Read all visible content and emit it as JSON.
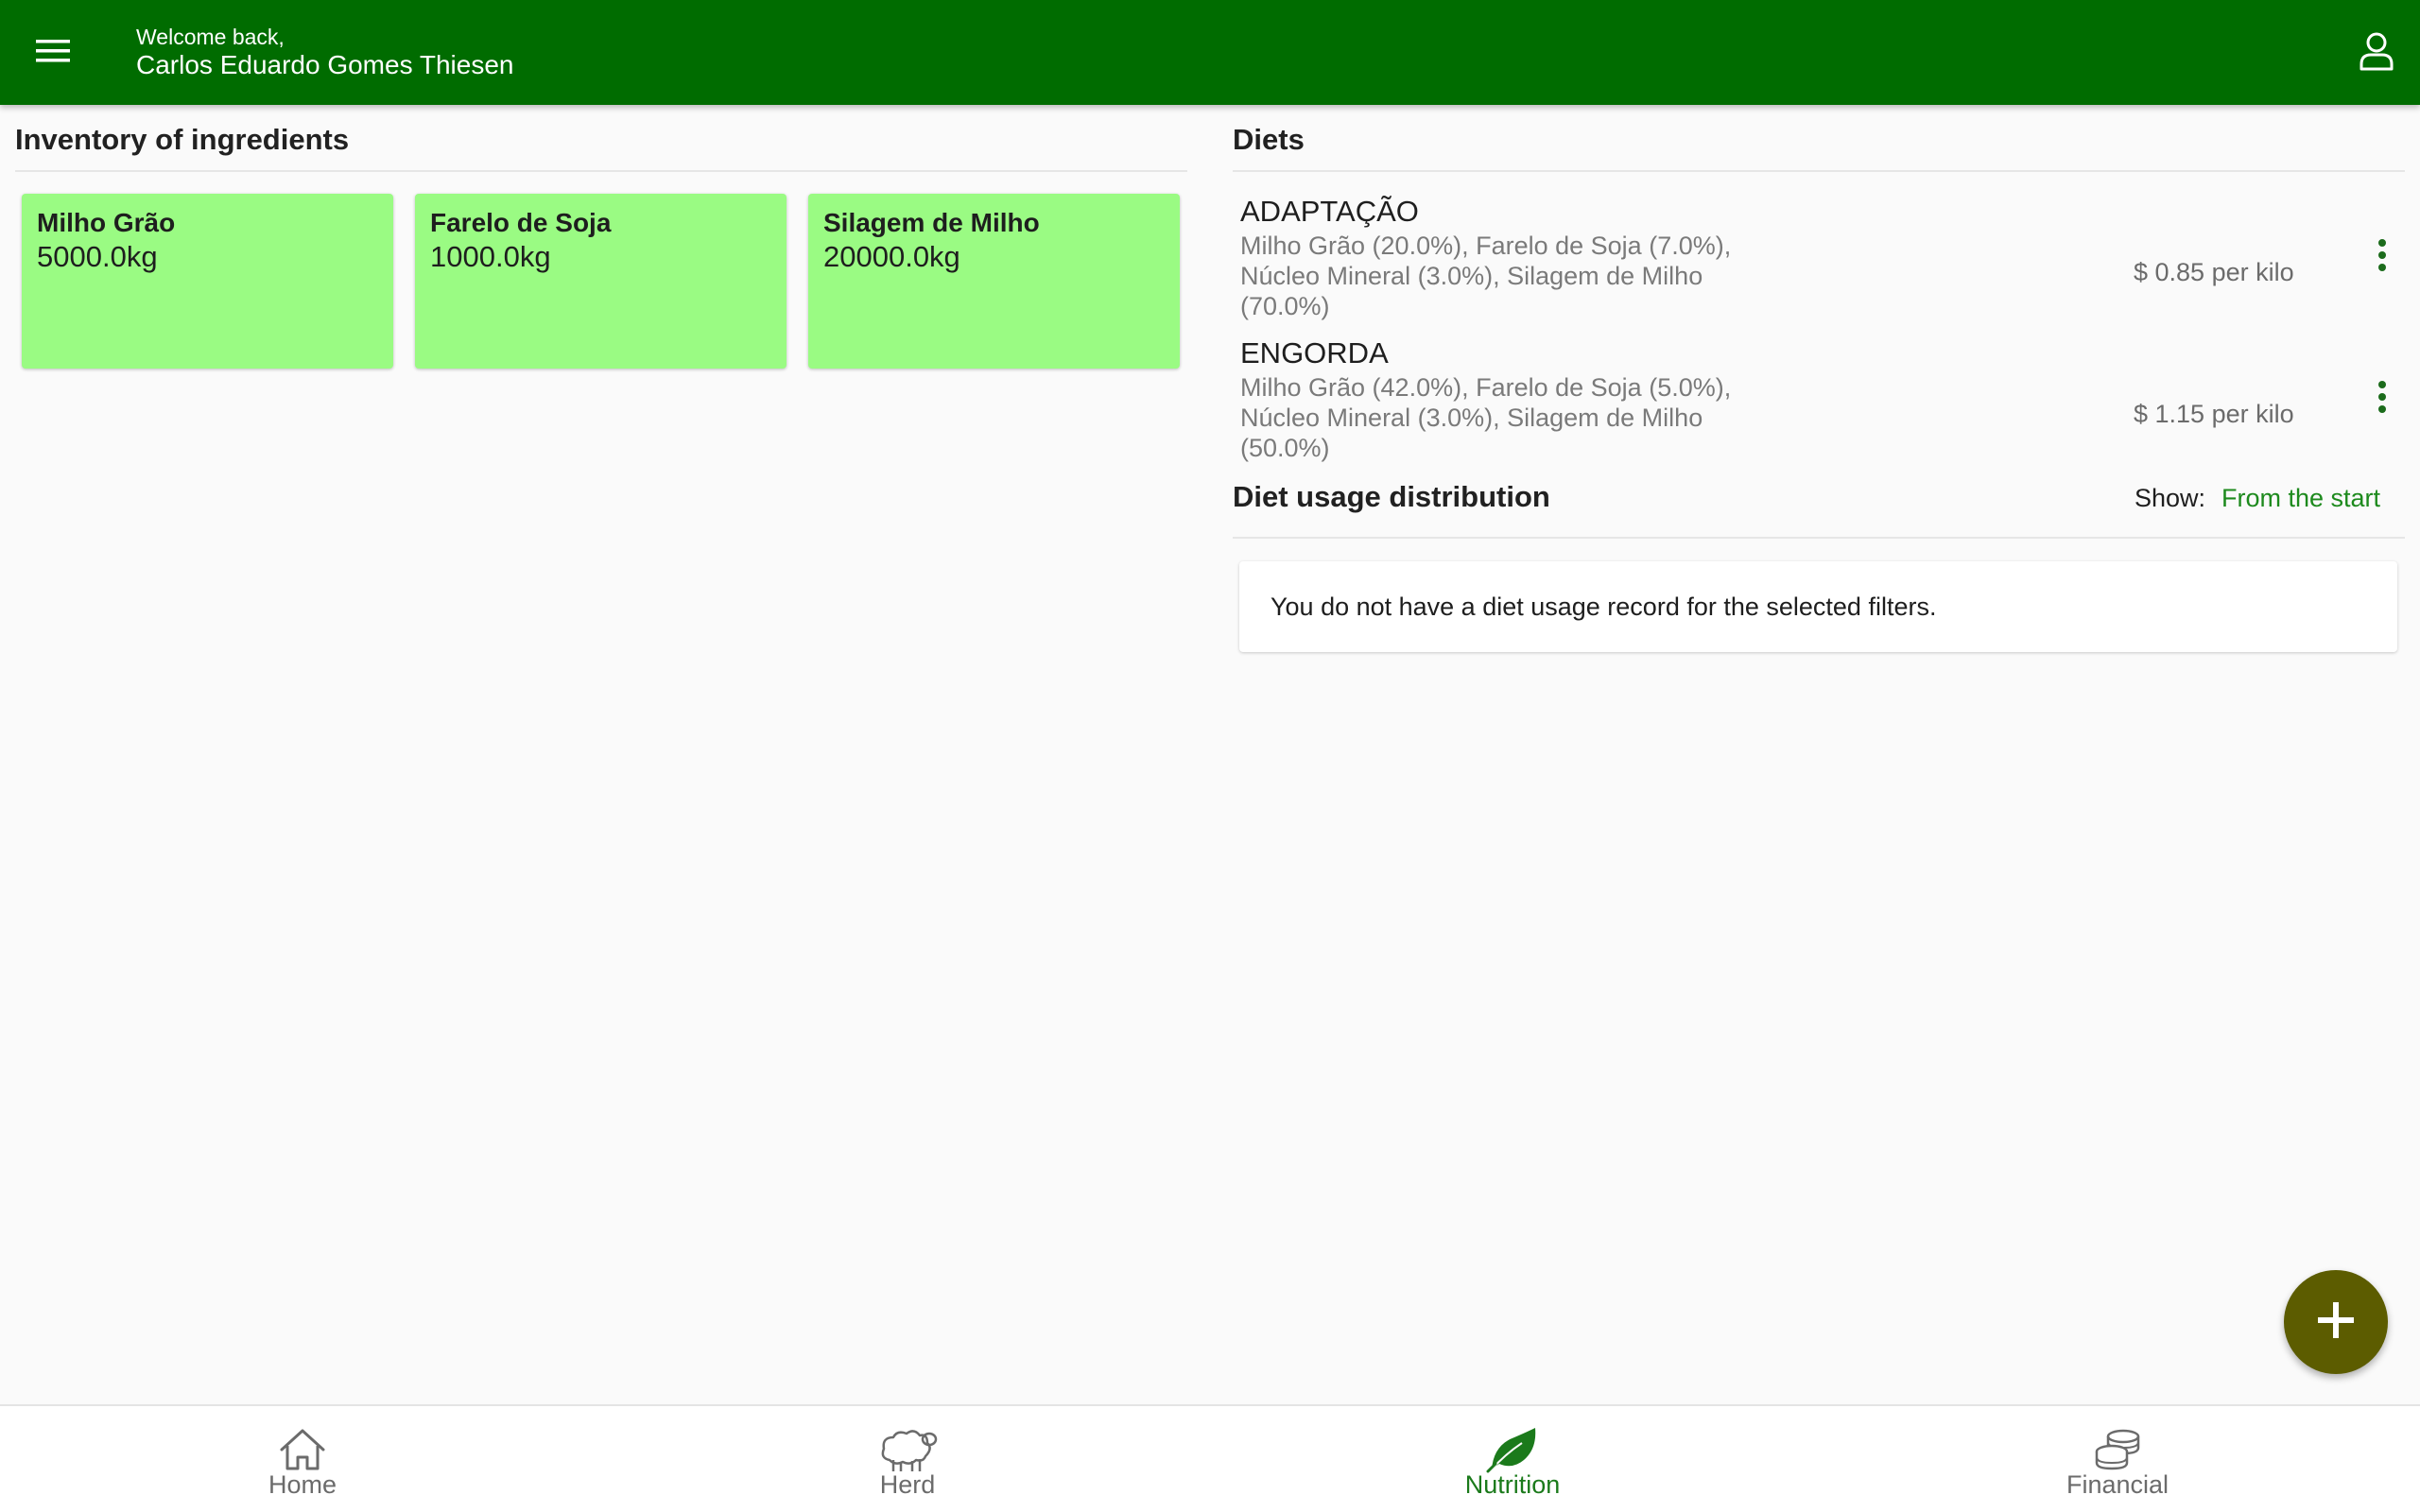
{
  "appbar": {
    "greeting": "Welcome back,",
    "user_name": "Carlos Eduardo Gomes Thiesen",
    "color": "#006c00",
    "menu_icon": "hamburger-menu-icon",
    "account_icon": "person-icon"
  },
  "inventory": {
    "title": "Inventory of ingredients",
    "card_color": "#9afb83",
    "items": [
      {
        "name": "Milho Grão",
        "quantity": "5000.0kg"
      },
      {
        "name": "Farelo de Soja",
        "quantity": "1000.0kg"
      },
      {
        "name": "Silagem de Milho",
        "quantity": "20000.0kg"
      }
    ]
  },
  "diets": {
    "title": "Diets",
    "items": [
      {
        "name": "ADAPTAÇÃO",
        "composition": "Milho Grão (20.0%), Farelo de Soja (7.0%), Núcleo Mineral (3.0%), Silagem de Milho (70.0%)",
        "price": "$ 0.85 per kilo"
      },
      {
        "name": "ENGORDA",
        "composition": "Milho Grão (42.0%), Farelo de Soja (5.0%), Núcleo Mineral (3.0%), Silagem de Milho (50.0%)",
        "price": "$ 1.15 per kilo"
      }
    ]
  },
  "usage": {
    "title": "Diet usage distribution",
    "show_label": "Show:",
    "filter_value": "From the start",
    "empty_message": "You do not have a diet usage record for the selected filters."
  },
  "fab": {
    "icon": "plus-icon",
    "color": "#5c5c00"
  },
  "bottom_nav": {
    "active": "Nutrition",
    "items": [
      {
        "label": "Home",
        "icon": "home-icon"
      },
      {
        "label": "Herd",
        "icon": "sheep-icon"
      },
      {
        "label": "Nutrition",
        "icon": "leaf-icon"
      },
      {
        "label": "Financial",
        "icon": "coins-icon"
      }
    ]
  }
}
